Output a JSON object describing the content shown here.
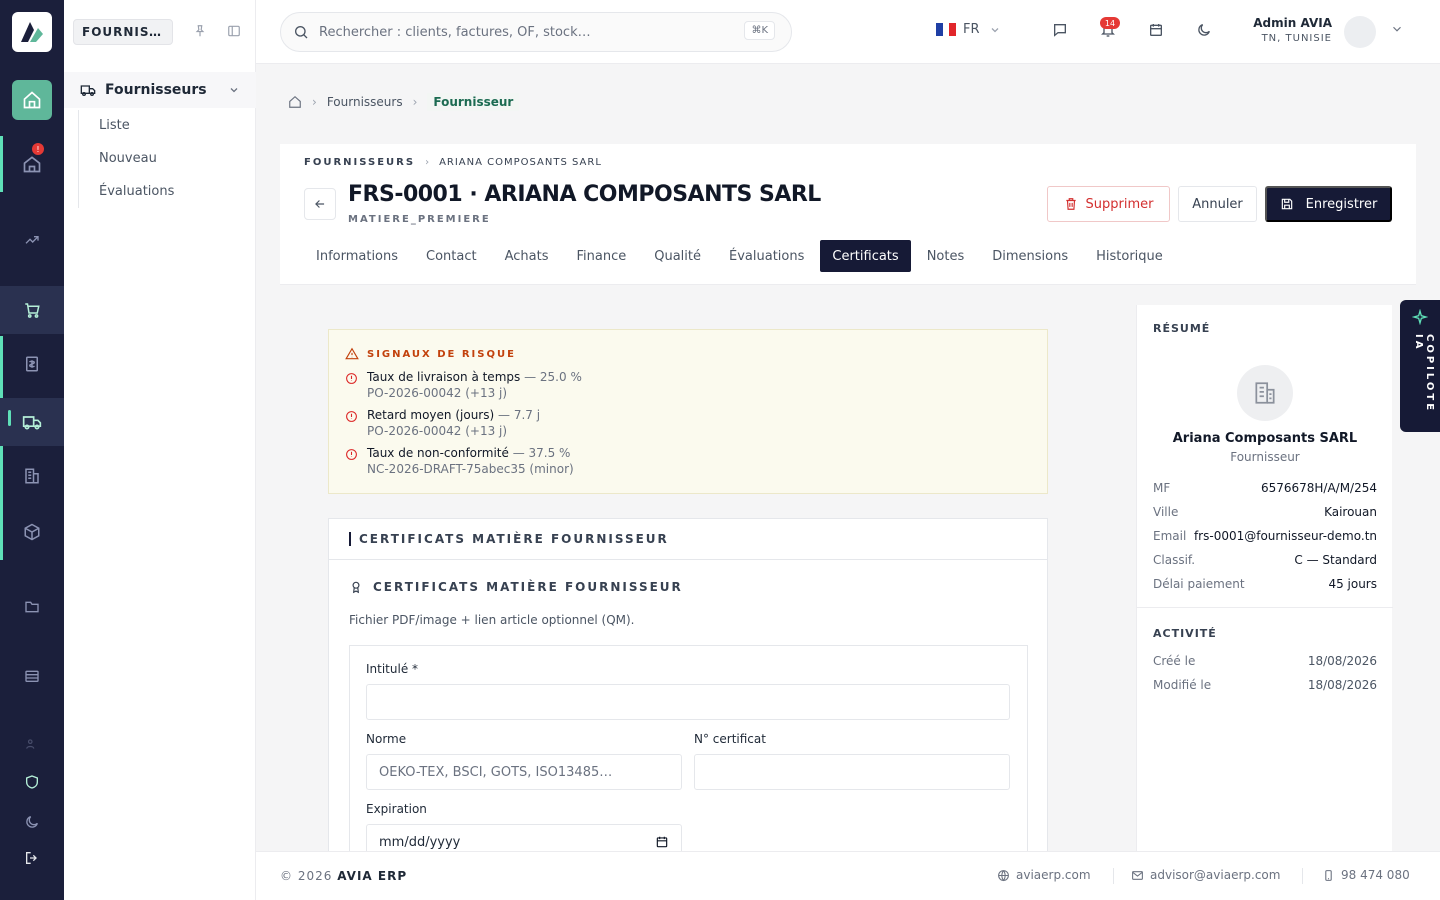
{
  "rail": {
    "items": [
      "home-icon",
      "inbox-icon",
      "chart-icon",
      "cart-icon",
      "invoice-icon",
      "truck-icon",
      "building-icon",
      "box-icon",
      "folder-icon",
      "archive-icon",
      "users-icon",
      "shield-icon",
      "moon-icon",
      "logout-icon"
    ],
    "inbox_badge": "!",
    "accent": "#5fe0b8",
    "bg": "#1b1f3b"
  },
  "submenu": {
    "header": "FOURNISSEURS",
    "group_label": "Fournisseurs",
    "items": [
      "Liste",
      "Nouveau",
      "Évaluations"
    ]
  },
  "topbar": {
    "search_placeholder": "Rechercher : clients, factures, OF, stock…",
    "shortcut": "⌘K",
    "language": "FR",
    "notifications_count": "14",
    "user_name": "Admin AVIA",
    "user_location": "TN, TUNISIE"
  },
  "breadcrumb": {
    "items": [
      "Fournisseurs",
      "Fournisseur"
    ]
  },
  "header": {
    "crumb_first": "FOURNISSEURS",
    "crumb_second": "ARIANA COMPOSANTS SARL",
    "title": "FRS-0001 · ARIANA COMPOSANTS SARL",
    "subtitle": "MATIERE_PREMIERE",
    "delete_label": "Supprimer",
    "cancel_label": "Annuler",
    "save_label": "Enregistrer"
  },
  "tabs": [
    "Informations",
    "Contact",
    "Achats",
    "Finance",
    "Qualité",
    "Évaluations",
    "Certificats",
    "Notes",
    "Dimensions",
    "Historique"
  ],
  "active_tab": "Certificats",
  "risk": {
    "title": "SIGNAUX DE RISQUE",
    "items": [
      {
        "label": "Taux de livraison à temps",
        "value": "— 25.0 %",
        "detail": "PO-2026-00042 (+13 j)"
      },
      {
        "label": "Retard moyen (jours)",
        "value": "— 7.7 j",
        "detail": "PO-2026-00042 (+13 j)"
      },
      {
        "label": "Taux de non-conformité",
        "value": "— 37.5 %",
        "detail": "NC-2026-DRAFT-75abec35 (minor)"
      }
    ]
  },
  "certificates": {
    "section_title": "CERTIFICATS MATIÈRE FOURNISSEUR",
    "sub_title": "CERTIFICATS MATIÈRE FOURNISSEUR",
    "description": "Fichier PDF/image + lien article optionnel (QM).",
    "form": {
      "title_label": "Intitulé *",
      "title_value": "",
      "norm_label": "Norme",
      "norm_placeholder": "OEKO-TEX, BSCI, GOTS, ISO13485…",
      "cert_number_label": "N° certificat",
      "cert_number_value": "",
      "expiration_label": "Expiration",
      "expiration_value": "mm/dd/yyyy"
    }
  },
  "summary": {
    "title": "RÉSUMÉ",
    "company_name": "Ariana Composants SARL",
    "company_role": "Fournisseur",
    "fields": [
      {
        "key": "MF",
        "value": "6576678H/A/M/254"
      },
      {
        "key": "Ville",
        "value": "Kairouan"
      },
      {
        "key": "Email",
        "value": "frs-0001@fournisseur-demo.tn"
      },
      {
        "key": "Classif.",
        "value": "C — Standard"
      },
      {
        "key": "Délai paiement",
        "value": "45 jours"
      }
    ],
    "activity_title": "ACTIVITÉ",
    "activity": [
      {
        "key": "Créé le",
        "value": "18/08/2026"
      },
      {
        "key": "Modifié le",
        "value": "18/08/2026"
      }
    ]
  },
  "copilot": {
    "label": "COPILOTE IA"
  },
  "footer": {
    "copyright": "© 2026",
    "brand": "AVIA ERP",
    "website": "aviaerp.com",
    "email": "advisor@aviaerp.com",
    "phone": "98 474 080"
  }
}
